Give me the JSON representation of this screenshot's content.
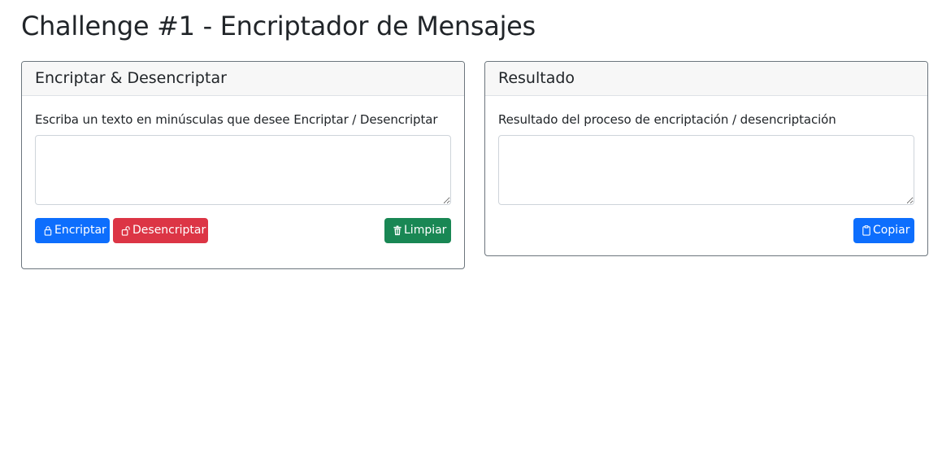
{
  "page": {
    "title": "Challenge #1 - Encriptador de Mensajes"
  },
  "input_card": {
    "header": "Encriptar & Desencriptar",
    "label": "Escriba un texto en minúsculas que desee Encriptar / Desencriptar",
    "textarea_value": "",
    "buttons": {
      "encrypt": {
        "label": "Encriptar",
        "icon": "lock-icon",
        "color": "#0d6efd"
      },
      "decrypt": {
        "label": "Desencriptar",
        "icon": "unlock-icon",
        "color": "#dc3545"
      },
      "clear": {
        "label": "Limpiar",
        "icon": "trash-icon",
        "color": "#198754"
      }
    }
  },
  "result_card": {
    "header": "Resultado",
    "label": "Resultado del proceso de encriptación / desencriptación",
    "textarea_value": "",
    "buttons": {
      "copy": {
        "label": "Copiar",
        "icon": "clipboard-icon",
        "color": "#0d6efd"
      }
    }
  }
}
